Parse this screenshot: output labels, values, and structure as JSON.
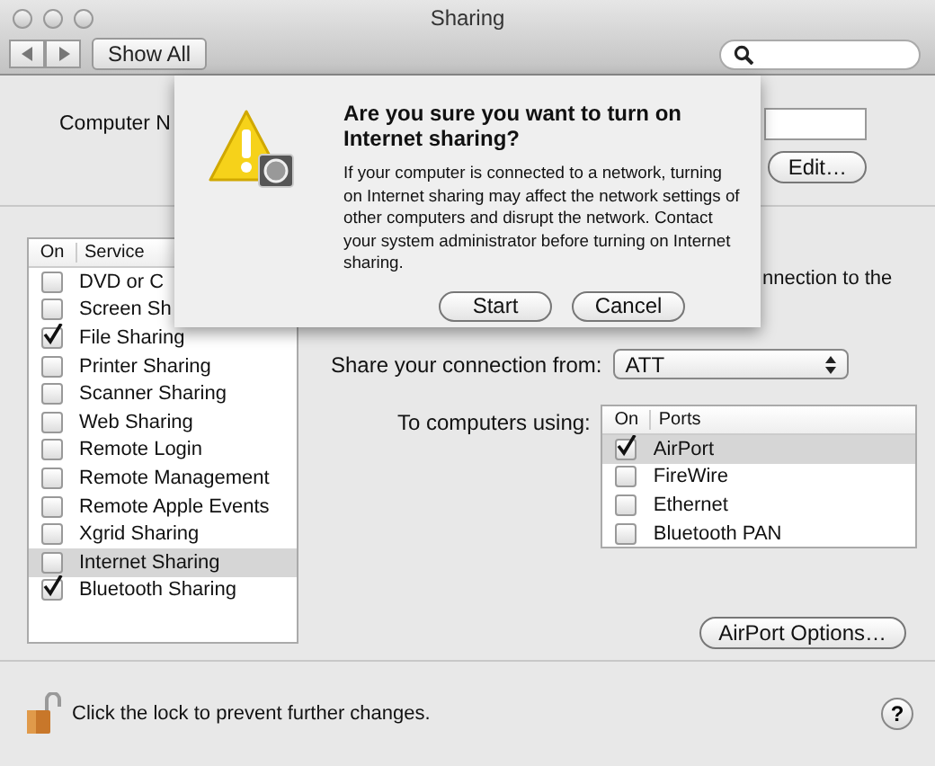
{
  "window": {
    "title": "Sharing"
  },
  "toolbar": {
    "show_all": "Show All"
  },
  "computer_name": {
    "label": "Computer N"
  },
  "edit_button": "Edit…",
  "services": {
    "columns": [
      "On",
      "Service"
    ],
    "rows": [
      {
        "name": "DVD or C",
        "checked": false,
        "selected": false
      },
      {
        "name": "Screen Sh",
        "checked": false,
        "selected": false
      },
      {
        "name": "File Sharing",
        "checked": true,
        "selected": false
      },
      {
        "name": "Printer Sharing",
        "checked": false,
        "selected": false
      },
      {
        "name": "Scanner Sharing",
        "checked": false,
        "selected": false
      },
      {
        "name": "Web Sharing",
        "checked": false,
        "selected": false
      },
      {
        "name": "Remote Login",
        "checked": false,
        "selected": false
      },
      {
        "name": "Remote Management",
        "checked": false,
        "selected": false
      },
      {
        "name": "Remote Apple Events",
        "checked": false,
        "selected": false
      },
      {
        "name": "Xgrid Sharing",
        "checked": false,
        "selected": false
      },
      {
        "name": "Internet Sharing",
        "checked": false,
        "selected": true
      },
      {
        "name": "Bluetooth Sharing",
        "checked": true,
        "selected": false
      }
    ]
  },
  "detail": {
    "fragment": "nnection to the",
    "share_from_label": "Share your connection from:",
    "share_from_value": "ATT",
    "to_label": "To computers using:",
    "ports": {
      "columns": [
        "On",
        "Ports"
      ],
      "rows": [
        {
          "name": "AirPort",
          "checked": true,
          "selected": true
        },
        {
          "name": "FireWire",
          "checked": false,
          "selected": false
        },
        {
          "name": "Ethernet",
          "checked": false,
          "selected": false
        },
        {
          "name": "Bluetooth PAN",
          "checked": false,
          "selected": false
        }
      ]
    },
    "airport_options": "AirPort Options…"
  },
  "footer": {
    "lock_text": "Click the lock to prevent further changes.",
    "help": "?"
  },
  "sheet": {
    "title": "Are you sure you want to turn on Internet sharing?",
    "message": "If your computer is connected to a network, turning on Internet sharing may affect the network settings of other computers and disrupt the network. Contact your system administrator before turning on Internet sharing.",
    "buttons": [
      "Start",
      "Cancel"
    ]
  }
}
